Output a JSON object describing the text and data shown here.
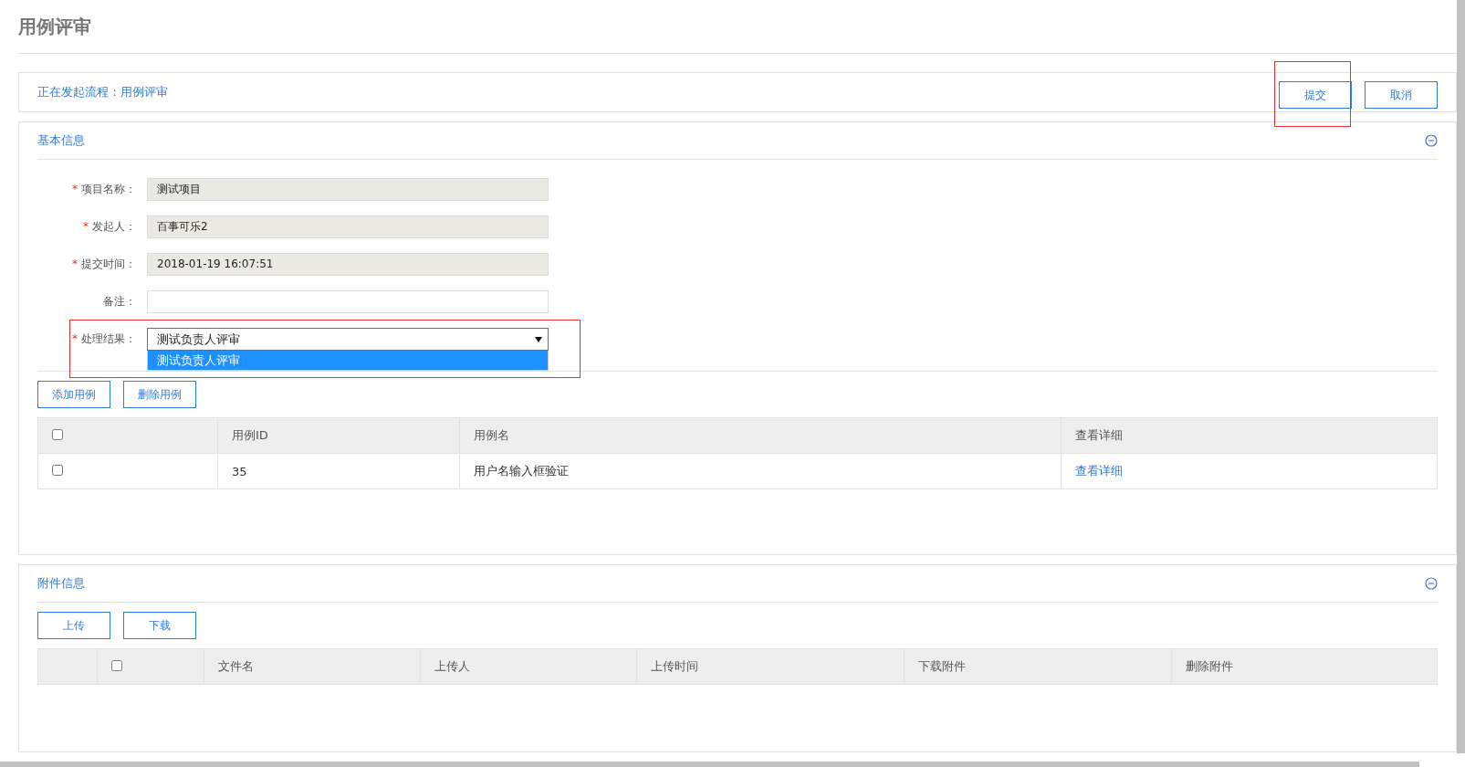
{
  "page_title": "用例评审",
  "process_bar": {
    "text": "正在发起流程：用例评审",
    "buttons": [
      {
        "label": "提交",
        "highlighted": true
      },
      {
        "label": "取消",
        "highlighted": false
      }
    ]
  },
  "basic_info": {
    "title": "基本信息",
    "fields": [
      {
        "required_mark": "*",
        "label": "项目名称：",
        "kind": "readonly",
        "value": "测试项目"
      },
      {
        "required_mark": "*",
        "label": "发起人：",
        "kind": "readonly",
        "value": "百事可乐2"
      },
      {
        "required_mark": "*",
        "label": "提交时间：",
        "kind": "readonly",
        "value": "2018-01-19 16:07:51"
      },
      {
        "label": "备注：",
        "kind": "text"
      },
      {
        "required_mark": "*",
        "label": "处理结果：",
        "kind": "select",
        "value": "测试负责人评审",
        "expanded": true,
        "highlighted": true,
        "options": [
          {
            "label": "测试负责人评审",
            "selected": true
          }
        ]
      }
    ],
    "buttons": [
      "添加用例",
      "删除用例"
    ],
    "table": {
      "columns": [
        {
          "kind": "checkbox",
          "checked": false
        },
        {
          "kind": "text",
          "label": "用例ID"
        },
        {
          "kind": "text",
          "label": "用例名"
        },
        {
          "kind": "text",
          "label": "查看详细"
        }
      ],
      "rows": [
        {
          "checked": false,
          "id": "35",
          "name": "用户名输入框验证",
          "link": "查看详细"
        }
      ]
    }
  },
  "attachments": {
    "title": "附件信息",
    "buttons": [
      "上传",
      "下载"
    ],
    "table": {
      "columns": [
        {
          "kind": "blank"
        },
        {
          "kind": "checkbox",
          "checked": false
        },
        {
          "kind": "text",
          "label": "文件名"
        },
        {
          "kind": "text",
          "label": "上传人"
        },
        {
          "kind": "text",
          "label": "上传时间"
        },
        {
          "kind": "text",
          "label": "下载附件"
        },
        {
          "kind": "text",
          "label": "删除附件"
        }
      ]
    }
  }
}
